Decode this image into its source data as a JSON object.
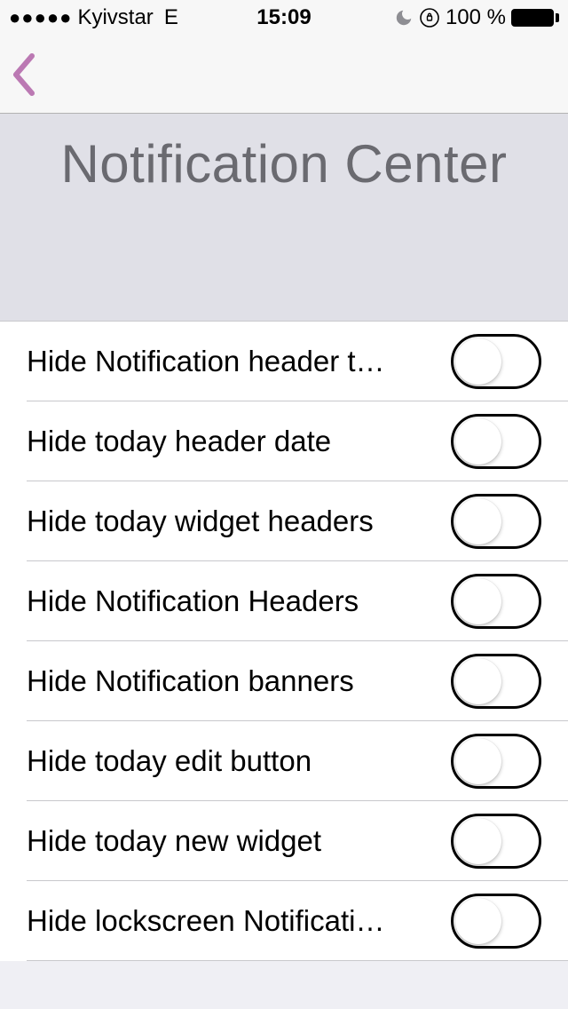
{
  "status": {
    "carrier": "Kyivstar",
    "network": "E",
    "time": "15:09",
    "battery_pct": "100 %"
  },
  "page": {
    "title": "Notification Center"
  },
  "settings": [
    {
      "label": "Hide Notification header tabs",
      "on": false
    },
    {
      "label": "Hide today header date",
      "on": false
    },
    {
      "label": "Hide today widget headers",
      "on": false
    },
    {
      "label": "Hide Notification Headers",
      "on": false
    },
    {
      "label": "Hide Notification banners",
      "on": false
    },
    {
      "label": "Hide today edit button",
      "on": false
    },
    {
      "label": "Hide today new widget",
      "on": false
    },
    {
      "label": "Hide lockscreen Notification…",
      "on": false
    }
  ]
}
